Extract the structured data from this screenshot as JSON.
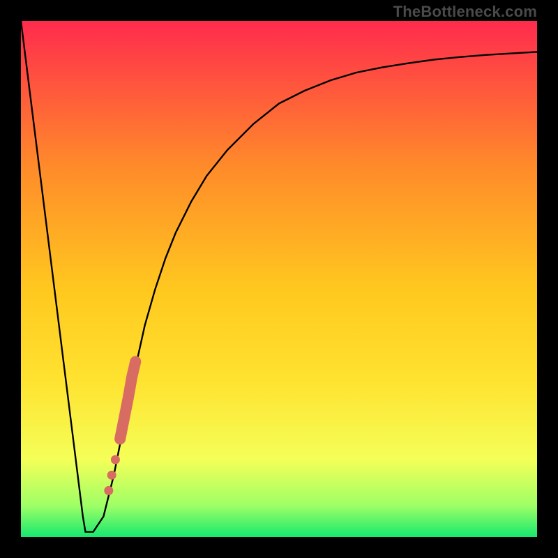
{
  "watermark": "TheBottleneck.com",
  "chart_data": {
    "type": "line",
    "title": "",
    "xlabel": "",
    "ylabel": "",
    "xlim": [
      0,
      100
    ],
    "ylim": [
      0,
      100
    ],
    "grid": false,
    "legend": false,
    "series": [
      {
        "name": "bottleneck-curve",
        "x": [
          0,
          2,
          4,
          6,
          8,
          10,
          12,
          12.5,
          13,
          14,
          16,
          18,
          20,
          22,
          24,
          26,
          28,
          30,
          33,
          36,
          40,
          45,
          50,
          55,
          60,
          65,
          70,
          75,
          80,
          85,
          90,
          95,
          100
        ],
        "y": [
          100,
          84,
          68,
          52,
          36,
          20,
          4,
          1,
          1,
          1,
          4,
          12,
          22,
          32,
          41,
          48,
          54,
          59,
          65,
          70,
          75,
          80,
          84,
          86.5,
          88.5,
          90,
          91,
          91.8,
          92.5,
          93,
          93.4,
          93.7,
          94
        ]
      }
    ],
    "markers": {
      "name": "highlight-dots",
      "color": "#d86b62",
      "points": [
        {
          "x": 17.0,
          "y": 9
        },
        {
          "x": 17.6,
          "y": 12
        },
        {
          "x": 18.3,
          "y": 15
        },
        {
          "x": 19.2,
          "y": 19
        },
        {
          "x": 20.0,
          "y": 23
        },
        {
          "x": 20.8,
          "y": 27
        },
        {
          "x": 21.5,
          "y": 31
        },
        {
          "x": 22.2,
          "y": 34
        }
      ]
    },
    "background_gradient": {
      "top": "#ff2b4d",
      "mid_upper": "#ff8a2a",
      "mid": "#ffe331",
      "mid_lower": "#f4ff58",
      "near_bottom": "#9dff66",
      "bottom": "#15e86f"
    }
  }
}
